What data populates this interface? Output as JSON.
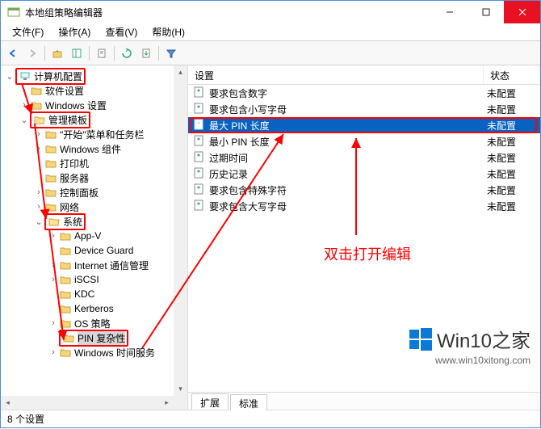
{
  "window": {
    "title": "本地组策略编辑器"
  },
  "menus": {
    "file": "文件(F)",
    "action": "操作(A)",
    "view": "查看(V)",
    "help": "帮助(H)"
  },
  "tree": {
    "root": {
      "label": "计算机配置"
    },
    "soft": {
      "label": "软件设置"
    },
    "winset": {
      "label": "Windows 设置"
    },
    "admintpl": {
      "label": "管理模板"
    },
    "startmenu": {
      "label": "\"开始\"菜单和任务栏"
    },
    "wincomp": {
      "label": "Windows 组件"
    },
    "printer": {
      "label": "打印机"
    },
    "server": {
      "label": "服务器"
    },
    "cpanel": {
      "label": "控制面板"
    },
    "network": {
      "label": "网络"
    },
    "system": {
      "label": "系统"
    },
    "appv": {
      "label": "App-V"
    },
    "devguard": {
      "label": "Device Guard"
    },
    "inetcomm": {
      "label": "Internet 通信管理"
    },
    "iscsi": {
      "label": "iSCSI"
    },
    "kdc": {
      "label": "KDC"
    },
    "kerberos": {
      "label": "Kerberos"
    },
    "ospolicy": {
      "label": "OS 策略"
    },
    "pincomp": {
      "label": "PIN 复杂性"
    },
    "wintime": {
      "label": "Windows 时间服务"
    }
  },
  "list": {
    "header_name": "设置",
    "header_state": "状态",
    "row0": {
      "name": "要求包含数字",
      "state": "未配置"
    },
    "row1": {
      "name": "要求包含小写字母",
      "state": "未配置"
    },
    "row2": {
      "name": "最大 PIN 长度",
      "state": "未配置"
    },
    "row3": {
      "name": "最小 PIN 长度",
      "state": "未配置"
    },
    "row4": {
      "name": "过期时间",
      "state": "未配置"
    },
    "row5": {
      "name": "历史记录",
      "state": "未配置"
    },
    "row6": {
      "name": "要求包含特殊字符",
      "state": "未配置"
    },
    "row7": {
      "name": "要求包含大写字母",
      "state": "未配置"
    }
  },
  "tabs": {
    "extend": "扩展",
    "standard": "标准"
  },
  "status": {
    "text": "8 个设置"
  },
  "annotation": {
    "tip": "双击打开编辑"
  },
  "watermark": {
    "brand": "Win10",
    "suffix": "之家",
    "url": "www.win10xitong.com"
  }
}
